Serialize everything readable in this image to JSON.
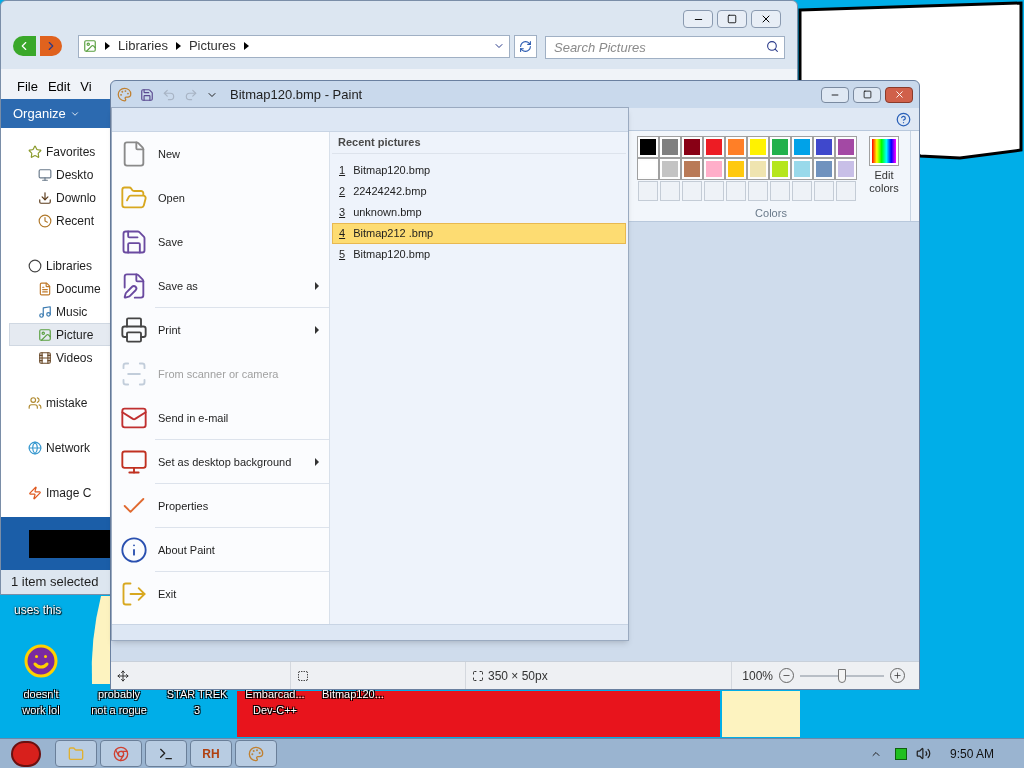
{
  "explorer": {
    "address": [
      "Libraries",
      "Pictures"
    ],
    "search": {
      "placeholder": "Search Pictures"
    },
    "menu": [
      "File",
      "Edit",
      "Vi"
    ],
    "organize": "Organize",
    "sidebar": [
      {
        "label": "Favorites",
        "kind": "star",
        "selected": false,
        "children": [
          {
            "label": "Deskto",
            "kind": "desktop",
            "selected": false
          },
          {
            "label": "Downlo",
            "kind": "download",
            "selected": false
          },
          {
            "label": "Recent",
            "kind": "recent",
            "selected": false
          }
        ]
      },
      {
        "label": "Libraries",
        "kind": "library",
        "selected": false,
        "children": [
          {
            "label": "Docume",
            "kind": "document",
            "selected": false
          },
          {
            "label": "Music",
            "kind": "music",
            "selected": false
          },
          {
            "label": "Picture",
            "kind": "picture",
            "selected": true
          },
          {
            "label": "Videos",
            "kind": "video",
            "selected": false
          }
        ]
      },
      {
        "label": "mistake",
        "kind": "homegroup",
        "selected": false
      },
      {
        "label": "Network",
        "kind": "network",
        "selected": false
      },
      {
        "label": "Image C",
        "kind": "capture",
        "selected": false
      }
    ],
    "status": "1 item selected"
  },
  "paint": {
    "title": "Bitmap120.bmp - Paint",
    "palette": [
      {
        "color": "#000000"
      },
      {
        "color": "#7f7f7f"
      },
      {
        "color": "#880015"
      },
      {
        "color": "#ed1c24"
      },
      {
        "color": "#ff7f27"
      },
      {
        "color": "#fff200"
      },
      {
        "color": "#22b14c"
      },
      {
        "color": "#00a2e8"
      },
      {
        "color": "#3f48cc"
      },
      {
        "color": "#a349a4"
      },
      {
        "color": "#ffffff"
      },
      {
        "color": "#c3c3c3"
      },
      {
        "color": "#b97a57"
      },
      {
        "color": "#ffaec9"
      },
      {
        "color": "#ffc90e"
      },
      {
        "color": "#efe4b0"
      },
      {
        "color": "#b5e61d"
      },
      {
        "color": "#99d9ea"
      },
      {
        "color": "#7092be"
      },
      {
        "color": "#c8bfe7"
      }
    ],
    "edit_colors": "Edit colors",
    "group_label": "Colors",
    "file_menu": {
      "items": [
        {
          "label": "New",
          "kind": "new",
          "submenu": false,
          "disabled": false,
          "separator_after": false
        },
        {
          "label": "Open",
          "kind": "open",
          "submenu": false,
          "disabled": false,
          "separator_after": false
        },
        {
          "label": "Save",
          "kind": "save",
          "submenu": false,
          "disabled": false,
          "separator_after": false
        },
        {
          "label": "Save as",
          "kind": "save_as",
          "submenu": true,
          "disabled": false,
          "separator_after": true
        },
        {
          "label": "Print",
          "kind": "print",
          "submenu": true,
          "disabled": false,
          "separator_after": false
        },
        {
          "label": "From scanner or camera",
          "kind": "scanner",
          "submenu": false,
          "disabled": true,
          "separator_after": false
        },
        {
          "label": "Send in e-mail",
          "kind": "email",
          "submenu": false,
          "disabled": false,
          "separator_after": true
        },
        {
          "label": "Set as desktop background",
          "kind": "desktop",
          "submenu": true,
          "disabled": false,
          "separator_after": true
        },
        {
          "label": "Properties",
          "kind": "properties",
          "submenu": false,
          "disabled": false,
          "separator_after": true
        },
        {
          "label": "About Paint",
          "kind": "about",
          "submenu": false,
          "disabled": false,
          "separator_after": true
        },
        {
          "label": "Exit",
          "kind": "exit",
          "submenu": false,
          "disabled": false,
          "separator_after": false
        }
      ],
      "recent_title": "Recent pictures",
      "recent": [
        {
          "number": "1",
          "name": "Bitmap120.bmp",
          "selected": false
        },
        {
          "number": "2",
          "name": "22424242.bmp",
          "selected": false
        },
        {
          "number": "3",
          "name": "unknown.bmp",
          "selected": false
        },
        {
          "number": "4",
          "name": "Bitmap212 .bmp",
          "selected": true
        },
        {
          "number": "5",
          "name": "Bitmap120.bmp",
          "selected": false
        }
      ]
    },
    "status": {
      "size": "350 × 50px",
      "zoom": "100%",
      "zoom_slider": {
        "level": 0.5
      }
    }
  },
  "desktop_icons": [
    {
      "label": "doesn't\nwork lol",
      "kind": "yahoo"
    },
    {
      "label": "probably\nnot a rogue",
      "kind": "hidden"
    },
    {
      "label": "STAR TREK\n3",
      "kind": "hidden"
    },
    {
      "label": "Embarcad...\nDev-C++",
      "kind": "hidden"
    },
    {
      "label": "Bitmap120...",
      "kind": "hidden"
    }
  ],
  "desktop_label_top": "uses this",
  "taskbar": {
    "buttons": [
      {
        "kind": "explorer"
      },
      {
        "kind": "chrome"
      },
      {
        "kind": "cmd"
      },
      {
        "kind": "text",
        "label": "RH"
      },
      {
        "kind": "paint"
      }
    ],
    "clock": "9:50 AM"
  }
}
